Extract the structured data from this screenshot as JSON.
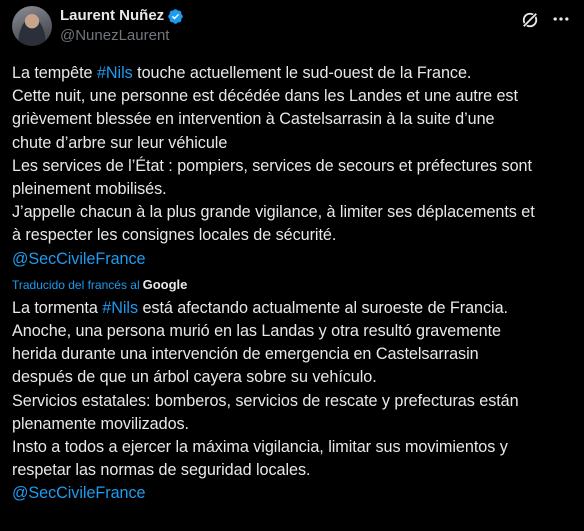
{
  "author": {
    "display_name": "Laurent Nuñez",
    "handle": "@NunezLaurent"
  },
  "original": {
    "lines": [
      {
        "pre": "La tempête ",
        "hashtag": "#Nils",
        "post": " touche actuellement le sud-ouest de la France."
      },
      {
        "text": "Cette nuit, une personne est décédée dans les Landes et une autre est"
      },
      {
        "text": "grièvement blessée en intervention à Castelsarrasin à la suite d’une"
      },
      {
        "text": "chute d’arbre sur leur véhicule"
      },
      {
        "text": "Les services de l’État : pompiers, services de secours et préfectures sont"
      },
      {
        "text": "pleinement mobilisés."
      },
      {
        "text": "J’appelle chacun à la plus grande vigilance, à limiter ses déplacements et"
      },
      {
        "text": "à respecter les consignes locales de sécurité."
      }
    ],
    "mention": "@SecCivileFrance"
  },
  "translation_note": {
    "label": "Traducido del francés al",
    "provider": "Google"
  },
  "translation": {
    "lines": [
      {
        "pre": "La tormenta ",
        "hashtag": "#Nils",
        "post": " está afectando actualmente al suroeste de Francia."
      },
      {
        "text": "Anoche, una persona murió en las Landas y otra resultó gravemente"
      },
      {
        "text": "herida durante una intervención de emergencia en Castelsarrasin"
      },
      {
        "text": "después de que un árbol cayera sobre su vehículo."
      },
      {
        "text": "Servicios estatales: bomberos, servicios de rescate y prefecturas están"
      },
      {
        "text": "plenamente movilizados."
      },
      {
        "text": "Insto a todos a ejercer la máxima vigilancia, limitar sus movimientos y"
      },
      {
        "text": "respetar las normas de seguridad locales."
      }
    ],
    "mention": "@SecCivileFrance"
  },
  "colors": {
    "background": "#000000",
    "text": "#e7e9ea",
    "secondary": "#71767b",
    "link": "#1d9bf0",
    "verified": "#1d9bf0"
  },
  "icons": {
    "verified": "verified-badge-icon",
    "grok": "grok-icon",
    "more": "more-horizontal-icon"
  }
}
